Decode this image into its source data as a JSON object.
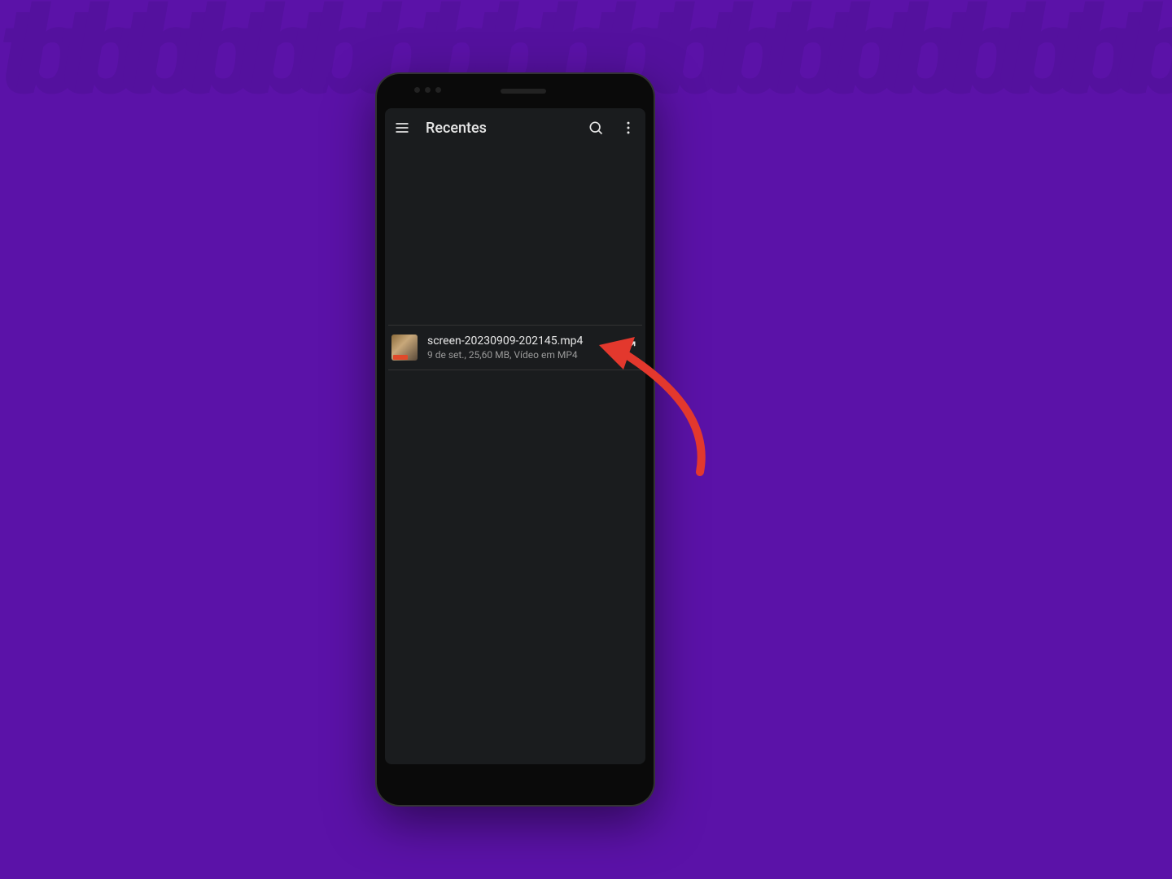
{
  "background": {
    "pattern_text": "tbtbtbtbtbtbtbtbtbtbtbtbtbtbtbtbtbtbtbtbtbtbtbtbtbtbtbtbtbtbtbtbtbtbtbtbtbtbtbtbtbtbtbtbtbtbtbtbtbtbtbtbtbtbtbtbtbtbtbtbtbtbtbtbtbtbtbtbtbtbtbtbtbtbtbtbtbtbtbtbtbtbtbtbtbtbtbtbtbtbtbtbtbtbtbtbtbtbtbtbtbtbtbtbtbtbtbtbtbtbtbtbtbtbtbtbtbtbtbtbtbtbtbtbtbtbtbtbtbtbtbtbtbtbtbtbtbtbtbtbtbtbtbtbtbtbtbtbtbtbtbtbtbtbtbtbtbtbtbtbtbtbtbtbtbtbtbtbtbtbtbtbtbtbtbtbtb"
  },
  "appbar": {
    "title": "Recentes",
    "menu_icon": "menu",
    "search_icon": "search",
    "more_icon": "more-vert"
  },
  "file": {
    "name": "screen-20230909-202145.mp4",
    "meta": "9 de set., 25,60 MB, Vídeo em MP4",
    "action_icon": "expand"
  },
  "colors": {
    "bg": "#5b12a8",
    "screen": "#1a1c1e",
    "annotation": "#e3382d"
  }
}
